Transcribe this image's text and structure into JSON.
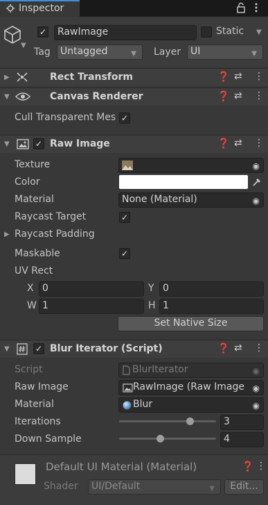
{
  "tab": {
    "title": "Inspector"
  },
  "gameobject": {
    "name": "RawImage",
    "static_label": "Static",
    "tag_label": "Tag",
    "tag_value": "Untagged",
    "layer_label": "Layer",
    "layer_value": "UI"
  },
  "components": {
    "rect_transform": {
      "title": "Rect Transform"
    },
    "canvas_renderer": {
      "title": "Canvas Renderer",
      "cull_label": "Cull Transparent Mes"
    },
    "raw_image": {
      "title": "Raw Image",
      "texture_label": "Texture",
      "color_label": "Color",
      "material_label": "Material",
      "material_value": "None (Material)",
      "raycast_target_label": "Raycast Target",
      "raycast_padding_label": "Raycast Padding",
      "maskable_label": "Maskable",
      "uv_rect_label": "UV Rect",
      "x_label": "X",
      "x_value": "0",
      "y_label": "Y",
      "y_value": "0",
      "w_label": "W",
      "w_value": "1",
      "h_label": "H",
      "h_value": "1",
      "set_native_size": "Set Native Size",
      "color_value": "#FFFFFF"
    },
    "blur_iterator": {
      "title": "Blur Iterator (Script)",
      "script_label": "Script",
      "script_value": "BlurIterator",
      "raw_image_label": "Raw Image",
      "raw_image_value": "RawImage (Raw Image",
      "material_label": "Material",
      "material_value": "Blur",
      "iterations_label": "Iterations",
      "iterations_value": "3",
      "iterations_fraction": 0.75,
      "down_sample_label": "Down Sample",
      "down_sample_value": "4",
      "down_sample_fraction": 0.42
    }
  },
  "material_footer": {
    "title": "Default UI Material (Material)",
    "shader_label": "Shader",
    "shader_value": "UI/Default",
    "edit_label": "Edit..."
  },
  "colors": {
    "background": "#383838",
    "header": "#3e3e3e",
    "accent": "#3d8fe0"
  }
}
